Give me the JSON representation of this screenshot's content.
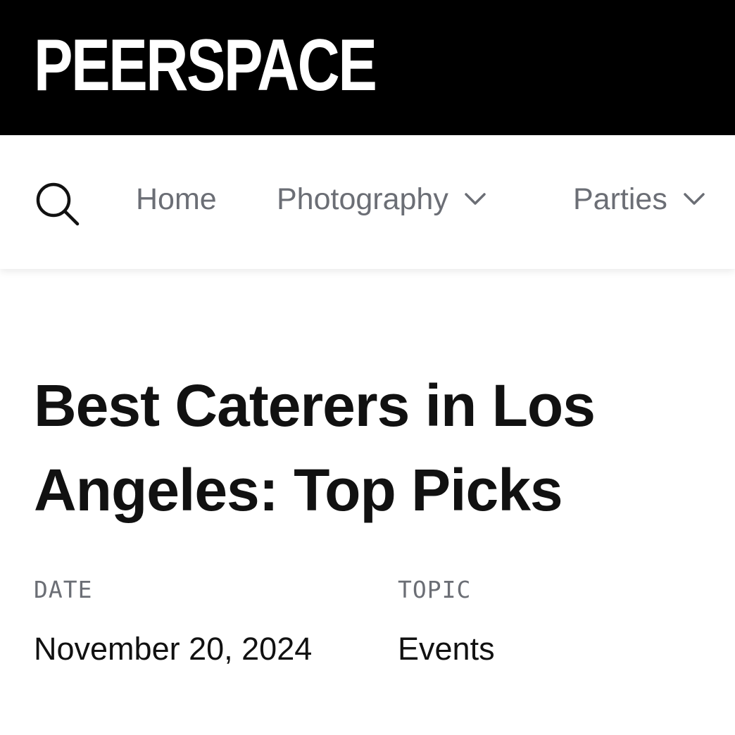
{
  "brand": {
    "logo_text": "PEERSPACE",
    "background_color": "#000000",
    "logo_color": "#ffffff"
  },
  "nav": {
    "search_icon": "search-icon",
    "items": [
      {
        "label": "Home",
        "has_dropdown": false
      },
      {
        "label": "Photography",
        "has_dropdown": true,
        "icon": "chevron-down-icon"
      },
      {
        "label": "Parties",
        "has_dropdown": true,
        "icon": "chevron-down-icon"
      }
    ],
    "text_color": "#6b6e75"
  },
  "article": {
    "title": "Best Caterers in Los Angeles: Top Picks",
    "date_label": "DATE",
    "date": "November 20, 2024",
    "topic_label": "TOPIC",
    "topic": "Events"
  }
}
